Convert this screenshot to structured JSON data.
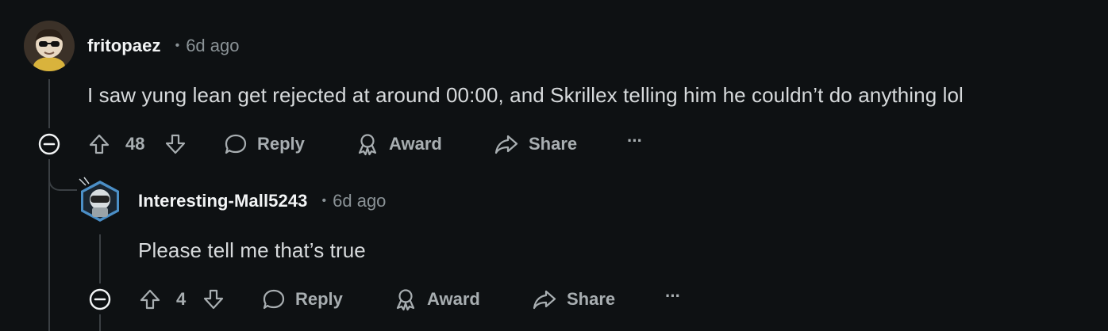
{
  "comments": [
    {
      "username": "fritopaez",
      "separator": "•",
      "timestamp": "6d ago",
      "body": "I saw yung lean get rejected at around 00:00, and Skrillex telling him he couldn’t do anything lol",
      "votes": "48",
      "actions": {
        "reply": "Reply",
        "award": "Award",
        "share": "Share",
        "more": "···"
      }
    },
    {
      "username": "Interesting-Mall5243",
      "separator": "•",
      "timestamp": "6d ago",
      "body": "Please tell me that’s true",
      "votes": "4",
      "actions": {
        "reply": "Reply",
        "award": "Award",
        "share": "Share",
        "more": "···"
      }
    }
  ],
  "icons": {
    "upvote": "arrow-up-outline",
    "downvote": "arrow-down-outline",
    "reply": "speech-bubble",
    "award": "award-ribbon",
    "share": "share-arrow",
    "collapse": "minus-circle",
    "more": "ellipsis"
  },
  "colors": {
    "background": "#0e1113",
    "thread_line": "#3a3f43",
    "text_primary": "#f2f4f5",
    "text_secondary": "#8a9296",
    "action_text": "#a8aeb1"
  }
}
